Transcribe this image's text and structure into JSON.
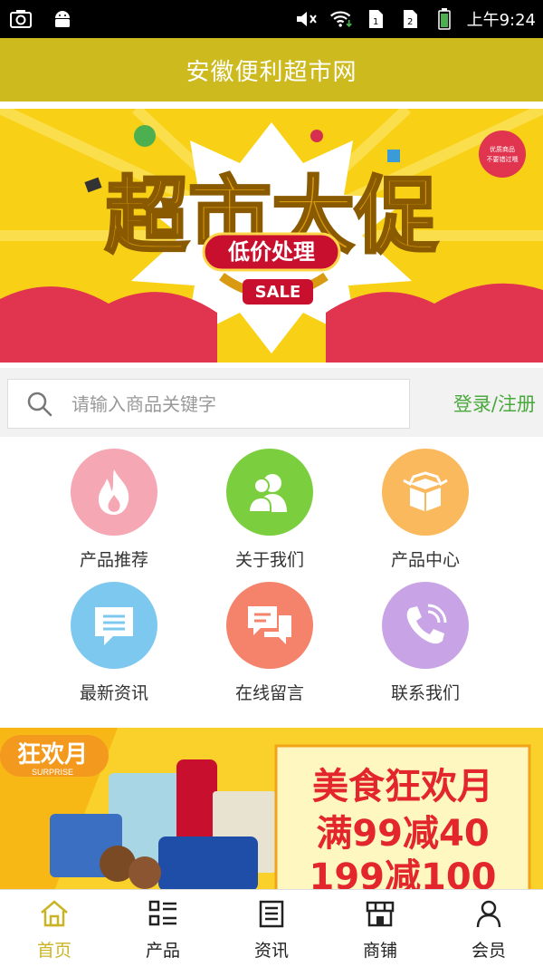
{
  "status_bar": {
    "time": "上午9:24",
    "icons": [
      "screenshot-icon",
      "android-icon",
      "mute-icon",
      "wifi-icon",
      "sim1-icon",
      "sim2-icon",
      "battery-icon"
    ]
  },
  "header": {
    "title": "安徽便利超市网"
  },
  "banner": {
    "headline": "超市大促",
    "subline": "低价处理",
    "tag": "SALE",
    "badge": "优质商品 不要错过哦"
  },
  "search": {
    "placeholder": "请输入商品关键字",
    "value": "",
    "login_label": "登录/注册"
  },
  "menu": {
    "items": [
      {
        "label": "产品推荐",
        "icon": "flame-icon",
        "color": "#f5a7b4"
      },
      {
        "label": "关于我们",
        "icon": "users-icon",
        "color": "#7bcf3f"
      },
      {
        "label": "产品中心",
        "icon": "box-icon",
        "color": "#fbb95e"
      },
      {
        "label": "最新资讯",
        "icon": "news-icon",
        "color": "#7dc8ef"
      },
      {
        "label": "在线留言",
        "icon": "chat-icon",
        "color": "#f5836c"
      },
      {
        "label": "联系我们",
        "icon": "phone-icon",
        "color": "#c8a3e6"
      }
    ]
  },
  "promo": {
    "tag": "狂欢月",
    "tag_sub": "SURPRISE",
    "title": "美食狂欢月",
    "line1": "满99减40",
    "line2": "199减100"
  },
  "bottom_nav": {
    "items": [
      {
        "label": "首页",
        "icon": "home-icon",
        "active": true
      },
      {
        "label": "产品",
        "icon": "grid-list-icon",
        "active": false
      },
      {
        "label": "资讯",
        "icon": "document-icon",
        "active": false
      },
      {
        "label": "商铺",
        "icon": "store-icon",
        "active": false
      },
      {
        "label": "会员",
        "icon": "user-icon",
        "active": false
      }
    ]
  },
  "colors": {
    "accent": "#cdba1e",
    "login_green": "#4aa93c",
    "active_nav": "#c9b424"
  }
}
